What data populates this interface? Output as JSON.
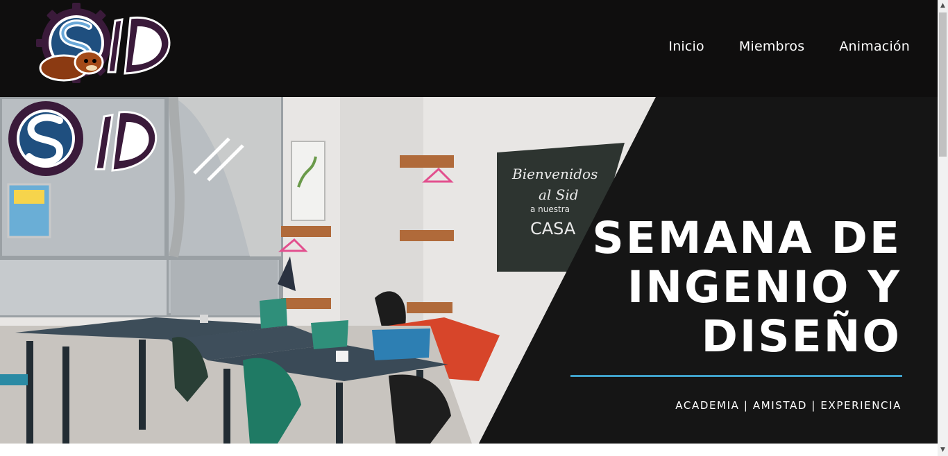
{
  "nav": {
    "logo_text": "SID",
    "links": [
      "Inicio",
      "Miembros",
      "Animación"
    ]
  },
  "hero": {
    "photo_logo_text": "SID",
    "chalkboard": [
      "Bienvenidos",
      "al Sid",
      "a nuestra",
      "CASA"
    ],
    "title_lines": [
      "SEMANA DE",
      "INGENIO Y",
      "DISEÑO"
    ],
    "tagline": "ACADEMIA | AMISTAD | EXPERIENCIA"
  },
  "colors": {
    "navbar_bg": "#0f0e0e",
    "hero_panel_bg": "#151515",
    "accent_line": "#3fa1c9",
    "logo_purple": "#3a1a3a",
    "logo_blue": "#2b5a8c"
  }
}
